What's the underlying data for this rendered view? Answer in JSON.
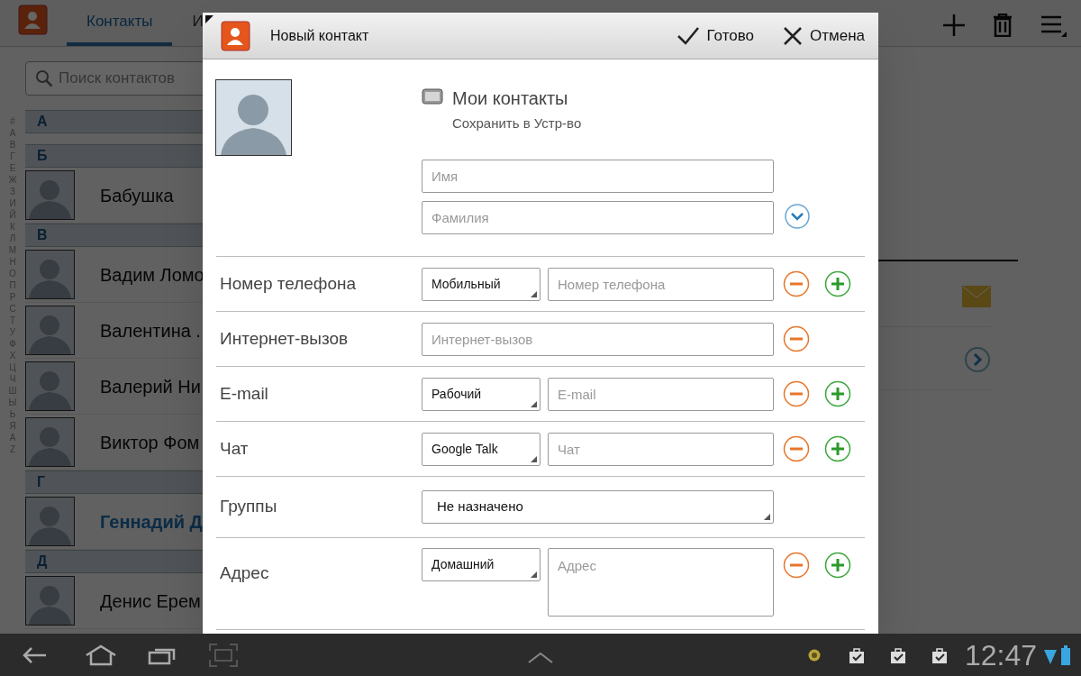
{
  "action_bar": {
    "tabs": [
      {
        "label": "Контакты",
        "selected": true
      },
      {
        "label": "И",
        "selected": false
      }
    ]
  },
  "search": {
    "placeholder": "Поиск контактов"
  },
  "index_letters": [
    "#",
    "А",
    "В",
    "Г",
    "Е",
    "Ж",
    "З",
    "И",
    "Й",
    "К",
    "Л",
    "М",
    "Н",
    "О",
    "П",
    "Р",
    "С",
    "Т",
    "У",
    "Ф",
    "Х",
    "Ц",
    "Ч",
    "Ш",
    "Ы",
    "Ь",
    "Я",
    "A",
    "Z"
  ],
  "contact_sections": [
    {
      "letter": "А"
    },
    {
      "letter": "Б",
      "contacts": [
        {
          "name": "Бабушка",
          "selected": false
        }
      ]
    },
    {
      "letter": "В",
      "contacts": [
        {
          "name": "Вадим Ломо",
          "selected": false
        },
        {
          "name": "Валентина .",
          "selected": false
        },
        {
          "name": "Валерий Ни",
          "selected": false
        },
        {
          "name": "Виктор Фом",
          "selected": false
        }
      ]
    },
    {
      "letter": "Г",
      "contacts": [
        {
          "name": "Геннадий Д",
          "selected": true
        }
      ]
    },
    {
      "letter": "Д",
      "contacts": [
        {
          "name": "Денис Ерем",
          "selected": false
        }
      ]
    }
  ],
  "dialog": {
    "title": "Новый контакт",
    "done": "Готово",
    "cancel": "Отмена",
    "account": {
      "name": "Мои контакты",
      "subtitle": "Сохранить в Устр-во"
    },
    "name_fields": [
      {
        "placeholder": "Имя"
      },
      {
        "placeholder": "Фамилия"
      }
    ],
    "rows": [
      {
        "kind": "field",
        "label": "Номер телефона",
        "type": "Мобильный",
        "placeholder": "Номер телефона",
        "addable": true
      },
      {
        "kind": "field",
        "label": "Интернет-вызов",
        "placeholder": "Интернет-вызов",
        "addable": false
      },
      {
        "kind": "field",
        "label": "E-mail",
        "type": "Рабочий",
        "placeholder": "E-mail",
        "addable": true
      },
      {
        "kind": "field",
        "label": "Чат",
        "type": "Google Talk",
        "placeholder": "Чат",
        "addable": true
      },
      {
        "kind": "select",
        "label": "Группы",
        "value": "Не назначено"
      },
      {
        "kind": "address",
        "label": "Адрес",
        "type": "Домашний",
        "placeholder": "Адрес",
        "addable": true
      }
    ]
  },
  "status_bar": {
    "time": "12:47"
  }
}
